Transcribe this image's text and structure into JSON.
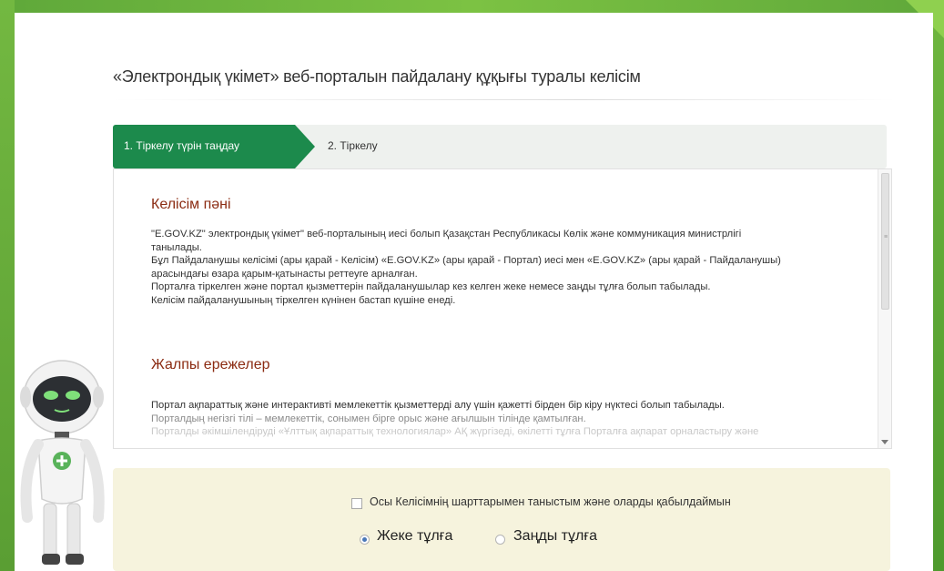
{
  "page": {
    "title": "«Электрондық үкімет» веб-порталын пайдалану құқығы туралы келісім"
  },
  "steps": [
    {
      "label": "1. Тіркелу түрін таңдау",
      "active": true
    },
    {
      "label": "2. Тіркелу",
      "active": false
    }
  ],
  "agreement": {
    "section1": {
      "title": "Келісім пәні",
      "lines": [
        "\"E.GOV.KZ\" электрондық үкімет\" веб-порталының иесі болып Қазақстан Республикасы Көлік және коммуникация министрлігі",
        "танылады.",
        "Бұл Пайдаланушы келісімі (ары қарай - Келісім) «E.GOV.KZ» (ары қарай - Портал) иесі мен «E.GOV.KZ» (ары қарай - Пайдаланушы)",
        "арасындағы өзара қарым-қатынасты реттеуге арналған.",
        "Порталға тіркелген және портал қызметтерін пайдаланушылар кез келген жеке немесе заңды тұлға болып табылады.",
        "Келісім пайдаланушының тіркелген күнінен бастап күшіне енеді."
      ]
    },
    "section2": {
      "title": "Жалпы ережелер",
      "lines": [
        "Портал ақпараттық және интерактивті мемлекеттік қызметтерді алу үшін қажетті бірден бір кіру нүктесі болып табылады.",
        "Порталдың негізгі тілі – мемлекеттік, сонымен бірге орыс және ағылшын тілінде қамтылған.",
        "Порталды әкімшілендіруді «Ұлттық ақпараттық технологиялар» АҚ жүргізеді, өкілетті тұлға Порталға ақпарат орналастыру және"
      ]
    }
  },
  "accept": {
    "checkbox_label": "Осы Келісімнің шарттарымен таныстым және оларды қабылдаймын",
    "checked": false,
    "radios": [
      {
        "label": "Жеке тұлға",
        "selected": true
      },
      {
        "label": "Заңды тұлға",
        "selected": false
      }
    ]
  },
  "colors": {
    "frame_green": "#6db33f",
    "step_active": "#1c8a4c",
    "section_title": "#8b2b12",
    "accept_panel": "#f6f3dd"
  }
}
